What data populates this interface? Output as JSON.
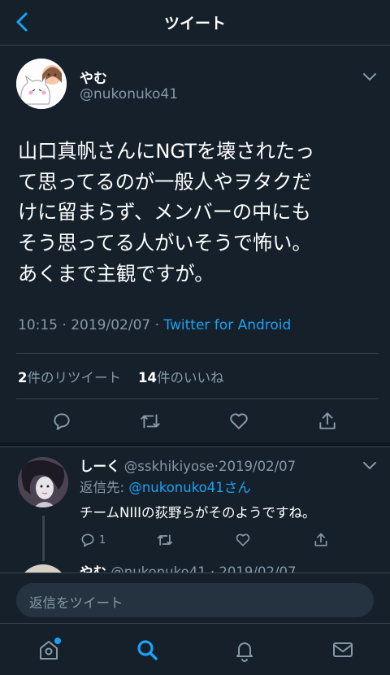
{
  "header": {
    "title": "ツイート",
    "back_icon": "chevron-left-icon"
  },
  "tweet": {
    "display_name": "やむ",
    "handle": "@nukonuko41",
    "text_lines": [
      "山口真帆さんにNGTを壊されたっ",
      "て思ってるのが一般人やヲタクだ",
      "けに留まらず、メンバーの中にも",
      "そう思ってる人がいそうで怖い。",
      "あくまで主観ですが。"
    ],
    "time": "10:15",
    "date": "2019/02/07",
    "separator": "·",
    "source": "Twitter for Android",
    "retweet_count": "2",
    "retweet_label": "件のリツイート",
    "like_count": "14",
    "like_label": "件のいいね"
  },
  "reply": {
    "display_name": "しーく",
    "handle": "@sskhikiyose",
    "date": "2019/02/07",
    "reply_label": "返信先: ",
    "reply_to": "@nukonuko41さん",
    "text": "チームNIIIの荻野らがそのようですね。",
    "reply_count": "1"
  },
  "partial_reply": {
    "display_name": "やむ",
    "meta": "@nukonuko41 · 2019/02/07"
  },
  "compose": {
    "placeholder": "返信をツイート"
  },
  "colors": {
    "accent": "#1da1f2",
    "background": "#15202b",
    "secondary_text": "#8899a6",
    "border": "#38444d"
  },
  "tabs": [
    {
      "icon": "home-icon",
      "has_notification_dot": true
    },
    {
      "icon": "search-icon",
      "active": true
    },
    {
      "icon": "bell-icon"
    },
    {
      "icon": "mail-icon"
    }
  ]
}
